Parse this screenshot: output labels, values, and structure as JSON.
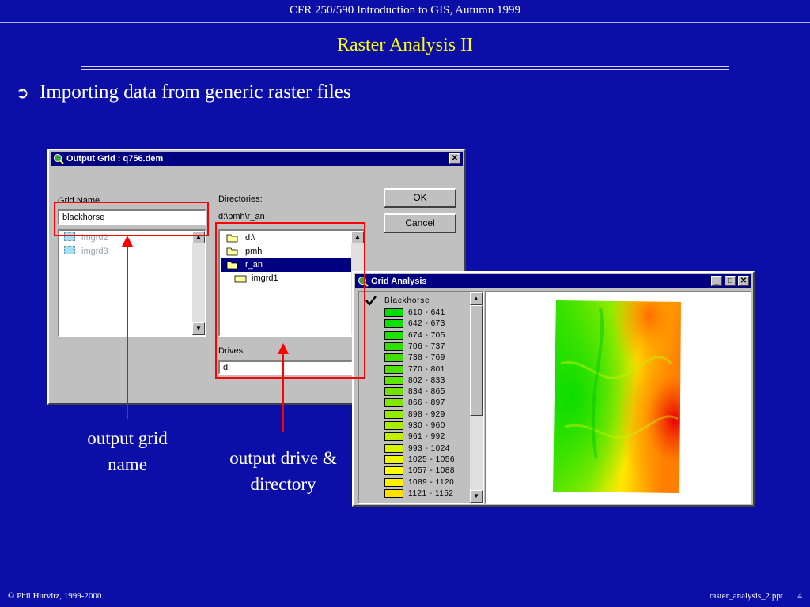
{
  "slide": {
    "header": "CFR 250/590 Introduction to GIS, Autumn 1999",
    "title": "Raster Analysis II",
    "bullet_glyph": "➲",
    "bullet": "Importing data from generic raster files",
    "footer_left": "© Phil Hurvitz, 1999-2000",
    "footer_right": "raster_analysis_2.ppt",
    "page_number": "4"
  },
  "output_grid_dialog": {
    "title": "Output Grid : q756.dem",
    "grid_name_label": "Grid Name",
    "grid_name_value": "blackhorse",
    "grid_list": [
      "imgrd2",
      "imgrd3"
    ],
    "directories_label": "Directories:",
    "current_path": "d:\\pmh\\r_an",
    "directories": [
      {
        "name": "d:\\",
        "selected": false
      },
      {
        "name": "pmh",
        "selected": false
      },
      {
        "name": "r_an",
        "selected": true
      },
      {
        "name": "imgrd1",
        "selected": false
      }
    ],
    "drives_label": "Drives:",
    "drive_value": "d:",
    "ok_label": "OK",
    "cancel_label": "Cancel",
    "close_glyph": "✕"
  },
  "grid_analysis_window": {
    "title": "Grid Analysis",
    "min_glyph": "_",
    "max_glyph": "□",
    "close_glyph": "✕",
    "legend_title": "Blackhorse",
    "legend": [
      {
        "range": "610 - 641",
        "color": "#00e000"
      },
      {
        "range": "642 - 673",
        "color": "#10e000"
      },
      {
        "range": "674 - 705",
        "color": "#20e000"
      },
      {
        "range": "706 - 737",
        "color": "#30e000"
      },
      {
        "range": "738 - 769",
        "color": "#40e000"
      },
      {
        "range": "770 - 801",
        "color": "#50e000"
      },
      {
        "range": "802 - 833",
        "color": "#60e400"
      },
      {
        "range": "834 - 865",
        "color": "#70e400"
      },
      {
        "range": "866 - 897",
        "color": "#80e800"
      },
      {
        "range": "898 - 929",
        "color": "#90ec00"
      },
      {
        "range": "930 - 960",
        "color": "#a8ec00"
      },
      {
        "range": "961 - 992",
        "color": "#c0f000"
      },
      {
        "range": "993 - 1024",
        "color": "#d8f400"
      },
      {
        "range": "1025 - 1056",
        "color": "#f0f800"
      },
      {
        "range": "1057 - 1088",
        "color": "#ffff00"
      },
      {
        "range": "1089 - 1120",
        "color": "#fff000"
      },
      {
        "range": "1121 - 1152",
        "color": "#ffe000"
      }
    ]
  },
  "annotations": {
    "grid_name": [
      "output grid",
      "name"
    ],
    "drive_dir": [
      "output drive &",
      "directory"
    ]
  }
}
